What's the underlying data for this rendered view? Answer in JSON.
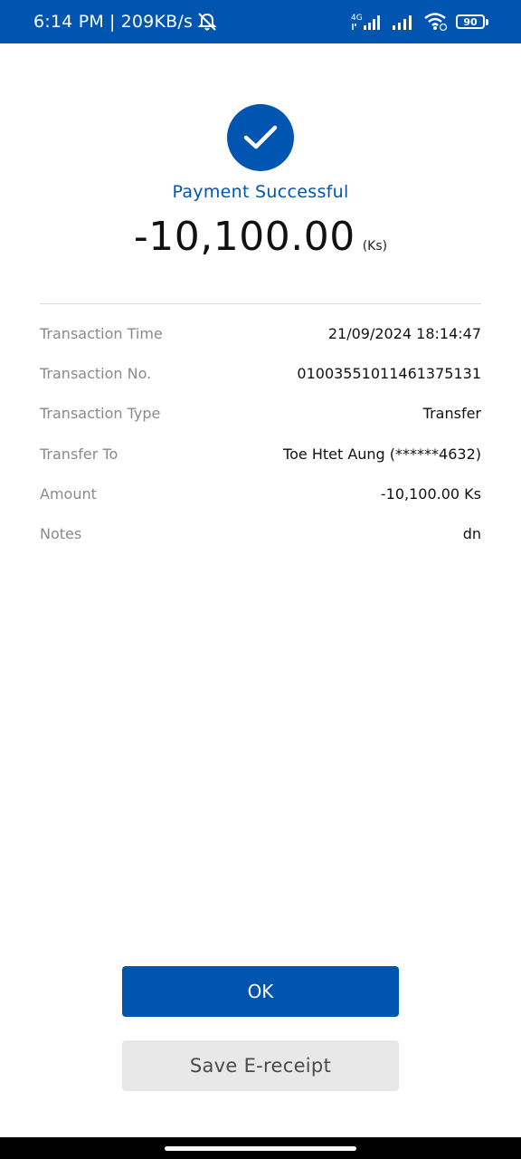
{
  "status_bar": {
    "time": "6:14 PM",
    "separator": "|",
    "speed": "209KB/s",
    "network_label": "4G",
    "battery": "90",
    "icons": [
      "mute-icon",
      "signal-4g-icon",
      "signal-icon",
      "wifi-icon",
      "battery-icon"
    ]
  },
  "success": {
    "icon": "check-icon",
    "title": "Payment Successful",
    "amount": "-10,100.00",
    "currency": "(Ks)"
  },
  "details": [
    {
      "label": "Transaction Time",
      "value": "21/09/2024 18:14:47"
    },
    {
      "label": "Transaction No.",
      "value": "01003551011461375131"
    },
    {
      "label": "Transaction Type",
      "value": "Transfer"
    },
    {
      "label": "Transfer To",
      "value": "Toe Htet Aung (******4632)"
    },
    {
      "label": "Amount",
      "value": "-10,100.00 Ks"
    },
    {
      "label": "Notes",
      "value": "dn"
    }
  ],
  "buttons": {
    "ok_label": "OK",
    "save_label": "Save E-receipt"
  },
  "colors": {
    "primary": "#0055b0",
    "secondary_button": "#e8e8e8",
    "label_gray": "#8a8a8a"
  }
}
